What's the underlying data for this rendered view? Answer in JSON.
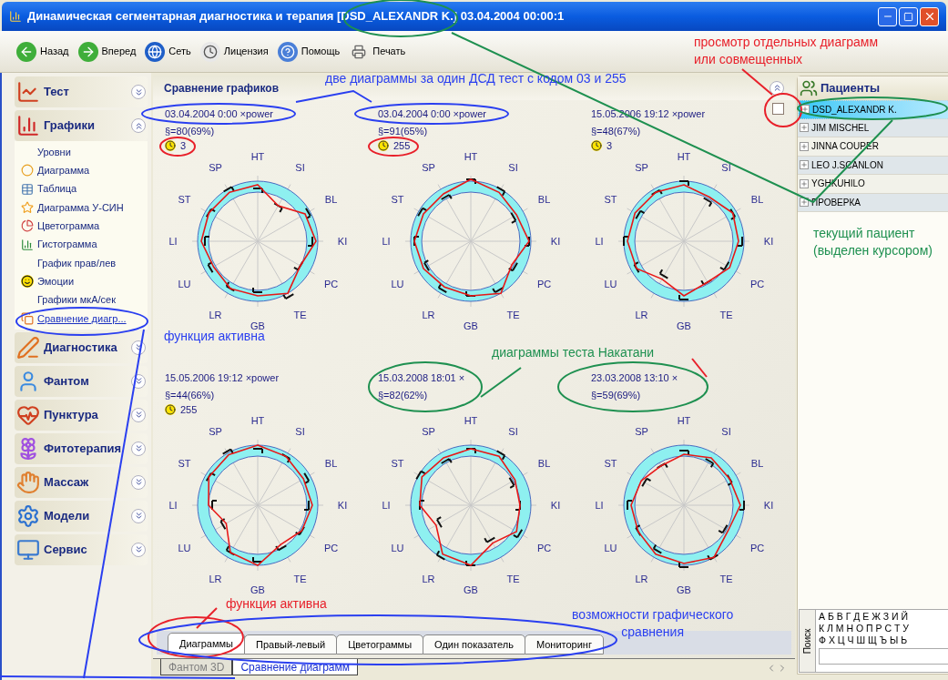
{
  "window": {
    "title": "Динамическая сегментарная диагностика и терапия [DSD_ALEXANDR K.] 03.04.2004 00:00:1"
  },
  "toolbar": [
    {
      "label": "Назад",
      "kind": "back"
    },
    {
      "label": "Вперед",
      "kind": "forward"
    },
    {
      "label": "Сеть",
      "kind": "globe"
    },
    {
      "label": "Лицензия",
      "kind": "clock"
    },
    {
      "label": "Помощь",
      "kind": "help"
    },
    {
      "label": "Печать",
      "kind": "print"
    }
  ],
  "sidebar": {
    "groups": [
      {
        "label": "Тест",
        "kind": "test",
        "expanded": false
      },
      {
        "label": "Графики",
        "kind": "charts",
        "expanded": true,
        "items": [
          {
            "label": "Уровни",
            "kind": "plain",
            "selected": false
          },
          {
            "label": "Диаграмма",
            "kind": "ring",
            "selected": false
          },
          {
            "label": "Таблица",
            "kind": "table",
            "selected": false
          },
          {
            "label": "Диаграмма У-СИН",
            "kind": "star",
            "selected": false
          },
          {
            "label": "Цветограмма",
            "kind": "pie",
            "selected": false
          },
          {
            "label": "Гистограмма",
            "kind": "bars",
            "selected": false
          },
          {
            "label": "График прав/лев",
            "kind": "plain",
            "selected": false
          },
          {
            "label": "Эмоции",
            "kind": "smiley",
            "selected": false
          },
          {
            "label": "Графики мкА/сек",
            "kind": "plain",
            "selected": false
          },
          {
            "label": "Сравнение диагр...",
            "kind": "compare",
            "selected": true
          }
        ]
      },
      {
        "label": "Диагностика",
        "kind": "diagnostics",
        "expanded": false
      },
      {
        "label": "Фантом",
        "kind": "phantom",
        "expanded": false
      },
      {
        "label": "Пунктура",
        "kind": "puncture",
        "expanded": false
      },
      {
        "label": "Фитотерапия",
        "kind": "phyto",
        "expanded": false
      },
      {
        "label": "Массаж",
        "kind": "massage",
        "expanded": false
      },
      {
        "label": "Модели",
        "kind": "models",
        "expanded": false
      },
      {
        "label": "Сервис",
        "kind": "service",
        "expanded": false
      }
    ]
  },
  "panel": {
    "title": "Сравнение графиков",
    "combined_checked": false,
    "diagrams": [
      {
        "date": "03.04.2004 0:00 ×power",
        "score": "§=80(69%)",
        "code": "3",
        "axes": [
          "HT",
          "SI",
          "BL",
          "KI",
          "PC",
          "TE",
          "GB",
          "LR",
          "LU",
          "LI",
          "ST",
          "SP"
        ]
      },
      {
        "date": "03.04.2004 0:00 ×power",
        "score": "§=91(65%)",
        "code": "255",
        "axes": [
          "HT",
          "SI",
          "BL",
          "KI",
          "PC",
          "TE",
          "GB",
          "LR",
          "LU",
          "LI",
          "ST",
          "SP"
        ]
      },
      {
        "date": "15.05.2006 19:12 ×power",
        "score": "§=48(67%)",
        "code": "3",
        "axes": [
          "HT",
          "SI",
          "BL",
          "KI",
          "PC",
          "TE",
          "GB",
          "LR",
          "LU",
          "LI",
          "ST",
          "SP"
        ]
      },
      {
        "date": "15.05.2006 19:12 ×power",
        "score": "§=44(66%)",
        "code": "255",
        "axes": [
          "HT",
          "SI",
          "BL",
          "KI",
          "PC",
          "TE",
          "GB",
          "LR",
          "LU",
          "LI",
          "ST",
          "SP"
        ]
      },
      {
        "date": "15.03.2008 18:01 ×",
        "score": "§=82(62%)",
        "axes": [
          "HT",
          "SI",
          "BL",
          "KI",
          "PC",
          "TE",
          "GB",
          "LR",
          "LU",
          "LI",
          "ST",
          "SP"
        ]
      },
      {
        "date": "23.03.2008 13:10 ×",
        "score": "§=59(69%)",
        "axes": [
          "HT",
          "SI",
          "BL",
          "KI",
          "PC",
          "TE",
          "GB",
          "LR",
          "LU",
          "LI",
          "ST",
          "SP"
        ]
      }
    ],
    "tabs": [
      {
        "label": "Диаграммы",
        "selected": true
      },
      {
        "label": "Правый-левый",
        "selected": false
      },
      {
        "label": "Цветограммы",
        "selected": false
      },
      {
        "label": "Один показатель",
        "selected": false
      },
      {
        "label": "Мониторинг",
        "selected": false
      }
    ]
  },
  "document_tabs": [
    {
      "label": "Фантом 3D",
      "selected": false
    },
    {
      "label": "Сравнение диаграмм",
      "selected": true
    }
  ],
  "patients": {
    "title": "Пациенты",
    "items": [
      {
        "name": "DSD_ALEXANDR K.",
        "selected": true
      },
      {
        "name": "JIM MISCHEL",
        "selected": false
      },
      {
        "name": "JINNA COUPER",
        "selected": false
      },
      {
        "name": "LEO J.SCANLON",
        "selected": false
      },
      {
        "name": "YGHKUHILO",
        "selected": false
      },
      {
        "name": "ПРОВЕРКА",
        "selected": false
      }
    ]
  },
  "search": {
    "label": "Поиск",
    "letter_rows": [
      "А Б В Г Д Е Ж З И Й",
      "К Л М Н О П Р С Т У",
      "Ф Х Ц Ч Ш Щ Ъ Ы Ь"
    ]
  },
  "annotations": [
    {
      "lines": [
        "две диаграммы за один ДСД тест с кодом 03 и 255"
      ],
      "color": "#2a3ff0"
    },
    {
      "lines": [
        "просмотр отдельных диаграмм",
        "или совмещенных"
      ],
      "color": "#e8202a"
    },
    {
      "lines": [
        "текущий пациент",
        "(выделен курсором)"
      ],
      "color": "#1e9050"
    },
    {
      "lines": [
        "функция активна"
      ],
      "color": "#2a3ff0"
    },
    {
      "lines": [
        "диаграммы теста Накатани"
      ],
      "color": "#1e9050"
    },
    {
      "lines": [
        "функция активна"
      ],
      "color": "#e8202a"
    },
    {
      "lines": [
        "возможности графического",
        "сравнения"
      ],
      "color": "#2a3ff0"
    }
  ]
}
